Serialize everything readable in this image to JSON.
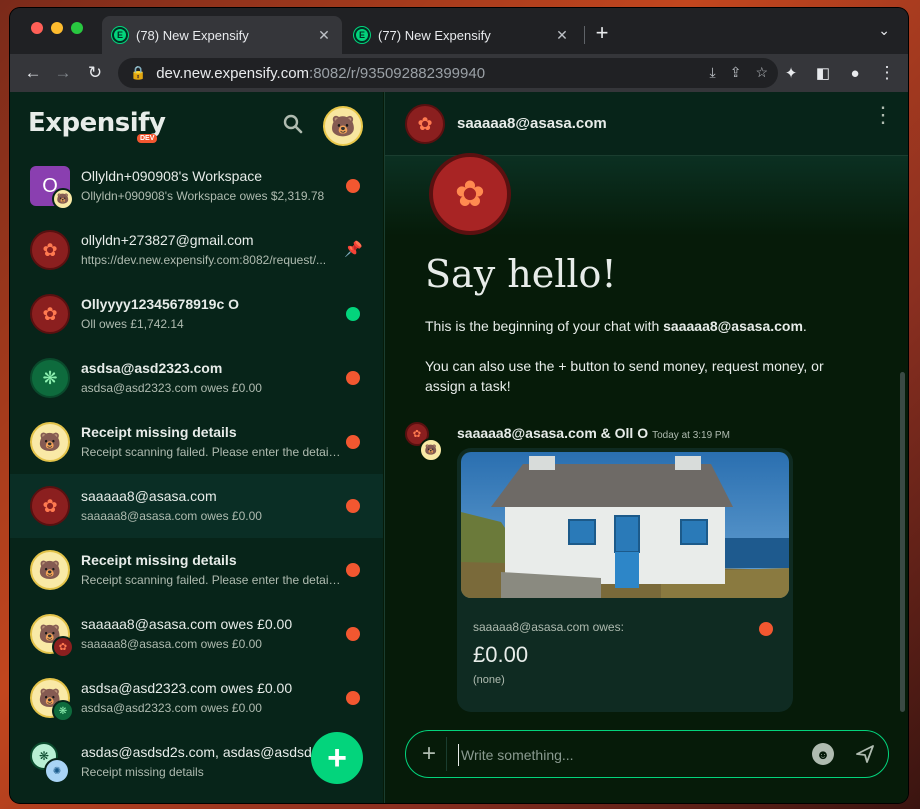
{
  "browser": {
    "tabs": [
      {
        "title": "(78) New Expensify",
        "active": true
      },
      {
        "title": "(77) New Expensify",
        "active": false
      }
    ],
    "url_host": "dev.new.expensify.com",
    "url_rest": ":8082/r/935092882399940"
  },
  "sidebar": {
    "logo": "Expensify",
    "dev_badge": "DEV",
    "items": [
      {
        "name": "Ollyldn+090908's Workspace",
        "preview": "Ollyldn+090908's Workspace owes $2,319.78",
        "bold": false,
        "indicator": "red-dot",
        "avatar": "O"
      },
      {
        "name": "ollyldn+273827@gmail.com",
        "preview": "https://dev.new.expensify.com:8082/request/...",
        "bold": false,
        "indicator": "pin"
      },
      {
        "name": "Ollyyyy12345678919c O",
        "preview": "Oll owes £1,742.14",
        "bold": true,
        "indicator": "green-dot"
      },
      {
        "name": "asdsa@asd2323.com",
        "preview": "asdsa@asd2323.com owes £0.00",
        "bold": true,
        "indicator": "red-dot"
      },
      {
        "name": "Receipt missing details",
        "preview": "Receipt scanning failed. Please enter the details...",
        "bold": true,
        "indicator": "red-dot"
      },
      {
        "name": "saaaaa8@asasa.com",
        "preview": "saaaaa8@asasa.com owes £0.00",
        "bold": false,
        "indicator": "red-dot",
        "selected": true
      },
      {
        "name": "Receipt missing details",
        "preview": "Receipt scanning failed. Please enter the details...",
        "bold": true,
        "indicator": "red-dot"
      },
      {
        "name": "saaaaa8@asasa.com owes £0.00",
        "preview": "saaaaa8@asasa.com owes £0.00",
        "bold": false,
        "indicator": "red-dot"
      },
      {
        "name": "asdsa@asd2323.com owes £0.00",
        "preview": "asdsa@asd2323.com owes £0.00",
        "bold": false,
        "indicator": "red-dot"
      },
      {
        "name": "asdas@asdsd2s.com, asdas@asdsd...",
        "preview": "Receipt missing details",
        "bold": false,
        "indicator": "red-dot"
      }
    ]
  },
  "chat": {
    "title": "saaaaa8@asasa.com",
    "say_hello": "Say hello!",
    "intro_prefix": "This is the beginning of your chat with ",
    "intro_email": "saaaaa8@asasa.com",
    "intro_suffix": ".",
    "intro2": "You can also use the + button to send money, request money, or assign a task!",
    "message": {
      "author": "saaaaa8@asasa.com & Oll O",
      "time": "Today at 3:19 PM",
      "owes_label": "saaaaa8@asasa.com owes:",
      "amount": "£0.00",
      "description": "(none)"
    },
    "composer_placeholder": "Write something..."
  },
  "colors": {
    "accent": "#03d47c",
    "danger": "#f25730",
    "background": "#061b09"
  }
}
